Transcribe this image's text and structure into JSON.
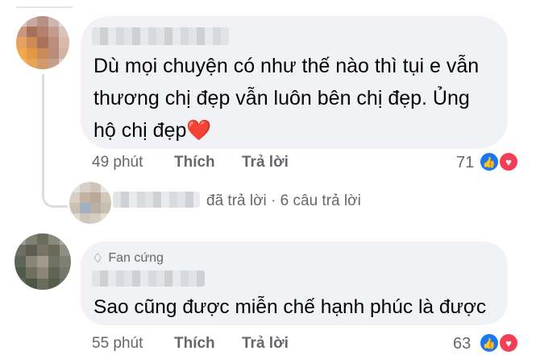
{
  "comments": [
    {
      "text_lines": [
        "Dù mọi chuyện có như thế nào thì tụi e vẫn",
        "thương chị đẹp vẫn luôn bên chị đẹp. Ủng",
        "hộ chị đẹp"
      ],
      "heart": "❤️",
      "time": "49 phút",
      "like_label": "Thích",
      "reply_label": "Trả lời",
      "reaction_count": "71",
      "reactions": [
        "like-icon",
        "love-icon"
      ]
    },
    {
      "badge": "Fan cứng",
      "badge_icon": "diamond-icon",
      "text": "Sao cũng được miễn chế hạnh phúc là được",
      "time": "55 phút",
      "like_label": "Thích",
      "reply_label": "Trả lời",
      "reaction_count": "63",
      "reactions": [
        "like-icon",
        "love-icon"
      ]
    }
  ],
  "reply_summary": {
    "replied_text": "đã trả lời",
    "separator": "·",
    "count_text": "6 câu trả lời"
  },
  "colors": {
    "bubble": "#f0f2f5",
    "meta_text": "#65676b",
    "like_blue": "#1877f2",
    "love_red": "#f33e58"
  }
}
